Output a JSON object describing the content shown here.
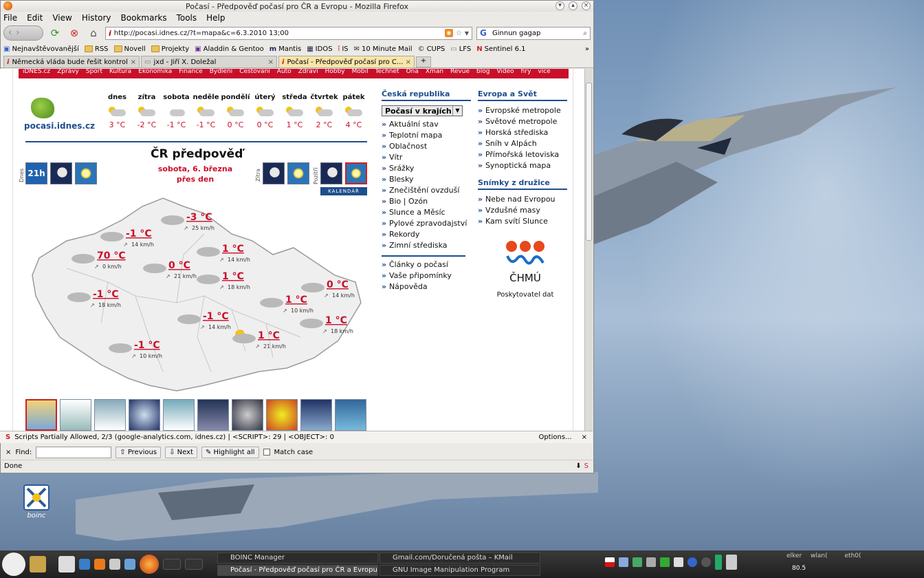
{
  "window": {
    "title": "Počasí - Předpověď počasí pro ČR a Evropu - Mozilla Firefox"
  },
  "menu": [
    "File",
    "Edit",
    "View",
    "History",
    "Bookmarks",
    "Tools",
    "Help"
  ],
  "nav": {
    "url": "http://pocasi.idnes.cz/?t=mapa&c=6.3.2010 13;00",
    "search_value": "Ginnun gagap"
  },
  "bookmarks": [
    "Nejnavštěvovanější",
    "RSS",
    "Novell",
    "Projekty",
    "Aladdin & Gentoo",
    "Mantis",
    "IDOS",
    "IS",
    "10 Minute Mail",
    "CUPS",
    "LFS",
    "Sentinel 6.1"
  ],
  "tabs": [
    {
      "title": "Německá vláda bude řešit kontrol...",
      "active": false
    },
    {
      "title": "jxd - Jiří X. Doležal",
      "active": false
    },
    {
      "title": "Počasí - Předpověď počasí pro Č...",
      "active": true
    }
  ],
  "site": {
    "topnav": [
      "iDNES.cz",
      "Zprávy",
      "Sport",
      "Kultura",
      "Ekonomika",
      "Finance",
      "Bydlení",
      "Cestování",
      "Auto",
      "Zdraví",
      "Hobby",
      "Mobil",
      "Technet",
      "Ona",
      "Xman",
      "Revue",
      "blog",
      "Video",
      "hry",
      "více"
    ],
    "logo_text": "pocasi.idnes.cz",
    "days": [
      {
        "name": "dnes",
        "temp": "3 °C",
        "sun": true
      },
      {
        "name": "zítra",
        "temp": "-2 °C",
        "sun": true
      },
      {
        "name": "sobota",
        "temp": "-1 °C",
        "sun": false
      },
      {
        "name": "neděle",
        "temp": "-1 °C",
        "sun": true
      },
      {
        "name": "pondělí",
        "temp": "0 °C",
        "sun": true
      },
      {
        "name": "úterý",
        "temp": "0 °C",
        "sun": true
      },
      {
        "name": "středa",
        "temp": "1 °C",
        "sun": true
      },
      {
        "name": "čtvrtek",
        "temp": "2 °C",
        "sun": true
      },
      {
        "name": "pátek",
        "temp": "4 °C",
        "sun": true
      }
    ],
    "forecast_title": "ČR předpověď",
    "forecast_date": "sobota, 6. března",
    "forecast_period": "přes den",
    "label_today": "Dnes",
    "label_tomorrow": "Zítra",
    "label_dayafter": "Pozítří",
    "tile_21h": "21h",
    "calendar": "KALENDÁŘ",
    "map_points": [
      {
        "temp": "-1 °C",
        "wind": "14 km/h",
        "sun": false
      },
      {
        "temp": "-3 °C",
        "wind": "25 km/h",
        "sun": false
      },
      {
        "temp": "70 °C",
        "wind": "0 km/h",
        "sun": false
      },
      {
        "temp": "0 °C",
        "wind": "21 km/h",
        "sun": false
      },
      {
        "temp": "1 °C",
        "wind": "14 km/h",
        "sun": false
      },
      {
        "temp": "1 °C",
        "wind": "18 km/h",
        "sun": false
      },
      {
        "temp": "0 °C",
        "wind": "14 km/h",
        "sun": false
      },
      {
        "temp": "-1 °C",
        "wind": "18 km/h",
        "sun": false
      },
      {
        "temp": "1 °C",
        "wind": "10 km/h",
        "sun": false
      },
      {
        "temp": "-1 °C",
        "wind": "14 km/h",
        "sun": false
      },
      {
        "temp": "1 °C",
        "wind": "18 km/h",
        "sun": false
      },
      {
        "temp": "-1 °C",
        "wind": "10 km/h",
        "sun": false
      },
      {
        "temp": "1 °C",
        "wind": "21 km/h",
        "sun": true
      }
    ],
    "cz": {
      "heading": "Česká republika",
      "select": "Počasí v krajích",
      "links": [
        "Aktuální stav",
        "Teplotní mapa",
        "Oblačnost",
        "Vítr",
        "Srážky",
        "Blesky",
        "Znečištění ovzduší",
        "Bio | Ozón",
        "Slunce a Měsíc",
        "Pylové zpravodajství",
        "Rekordy",
        "Zimní střediska"
      ],
      "links2": [
        "Články o počasí",
        "Vaše připomínky",
        "Nápověda"
      ]
    },
    "eu": {
      "heading": "Evropa a Svět",
      "links": [
        "Evropské metropole",
        "Světové metropole",
        "Horská střediska",
        "Sníh v Alpách",
        "Přímořská letoviska",
        "Synoptická mapa"
      ]
    },
    "sat": {
      "heading": "Snímky z družice",
      "links": [
        "Nebe nad Evropou",
        "Vzdušné masy",
        "Kam svítí Slunce"
      ]
    },
    "chmu_name": "ČHMÚ",
    "chmu_sub": "Poskytovatel dat"
  },
  "noscript": {
    "text": "Scripts Partially Allowed, 2/3 (google-analytics.com, idnes.cz) | <SCRIPT>: 29 | <OBJECT>: 0",
    "options": "Options..."
  },
  "find": {
    "label": "Find:",
    "previous": "Previous",
    "next": "Next",
    "highlight": "Highlight all",
    "match_case": "Match case"
  },
  "status": "Done",
  "desktop_icon": "boinc",
  "taskbar": {
    "tasks": [
      "BOINC Manager",
      "Gmail.com/Doručená pošta – KMail",
      "Počasí - Předpověď počasí pro ČR a Evropu",
      "GNU Image Manipulation Program"
    ],
    "net1": "elker",
    "net2": "wlan(",
    "net3": "eth0(",
    "value": "80.5"
  }
}
